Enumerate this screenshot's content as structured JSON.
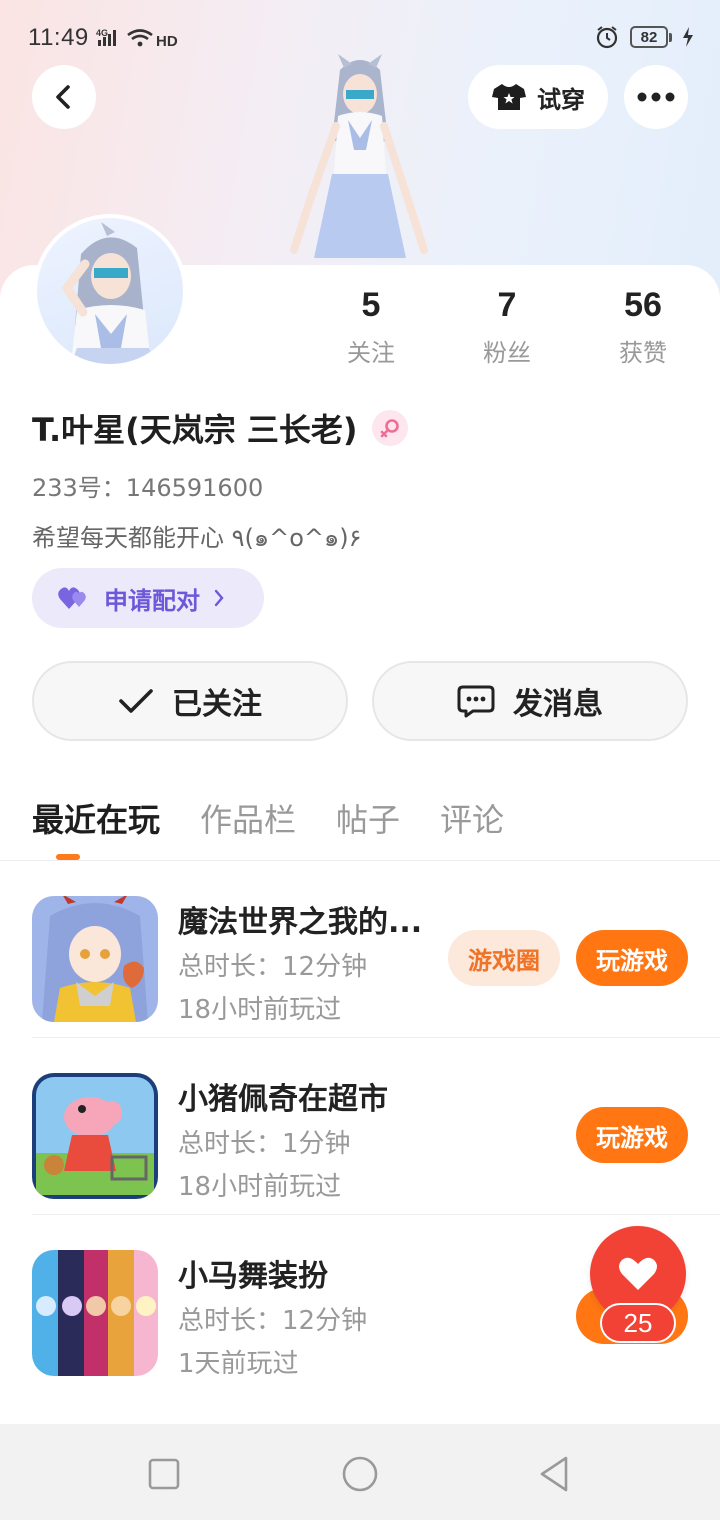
{
  "status_bar": {
    "time": "11:49",
    "network": "4G",
    "hd": "HD",
    "battery": "82"
  },
  "header": {
    "try_on_label": "试穿"
  },
  "profile": {
    "stats": [
      {
        "value": "5",
        "label": "关注"
      },
      {
        "value": "7",
        "label": "粉丝"
      },
      {
        "value": "56",
        "label": "获赞"
      }
    ],
    "username": "T.叶星(天岚宗 三长老)",
    "gender": "female",
    "id_text": "233号：146591600",
    "bio": "希望每天都能开心 ٩(๑^o^๑)۶",
    "pair_label": "申请配对",
    "following_label": "已关注",
    "message_label": "发消息"
  },
  "tabs": [
    {
      "label": "最近在玩",
      "active": true
    },
    {
      "label": "作品栏",
      "active": false
    },
    {
      "label": "帖子",
      "active": false
    },
    {
      "label": "评论",
      "active": false
    }
  ],
  "games": [
    {
      "title": "魔法世界之我的...",
      "duration": "总时长：12分钟",
      "last_played": "18小时前玩过",
      "circle_label": "游戏圈",
      "play_label": "玩游戏"
    },
    {
      "title": "小猪佩奇在超市",
      "duration": "总时长：1分钟",
      "last_played": "18小时前玩过",
      "play_label": "玩游戏"
    },
    {
      "title": "小马舞装扮",
      "duration": "总时长：12分钟",
      "last_played": "1天前玩过"
    }
  ],
  "floating_like": {
    "count": "25"
  },
  "colors": {
    "accent_orange": "#ff7613",
    "pair_purple": "#6c58d8",
    "like_red": "#f24236"
  }
}
